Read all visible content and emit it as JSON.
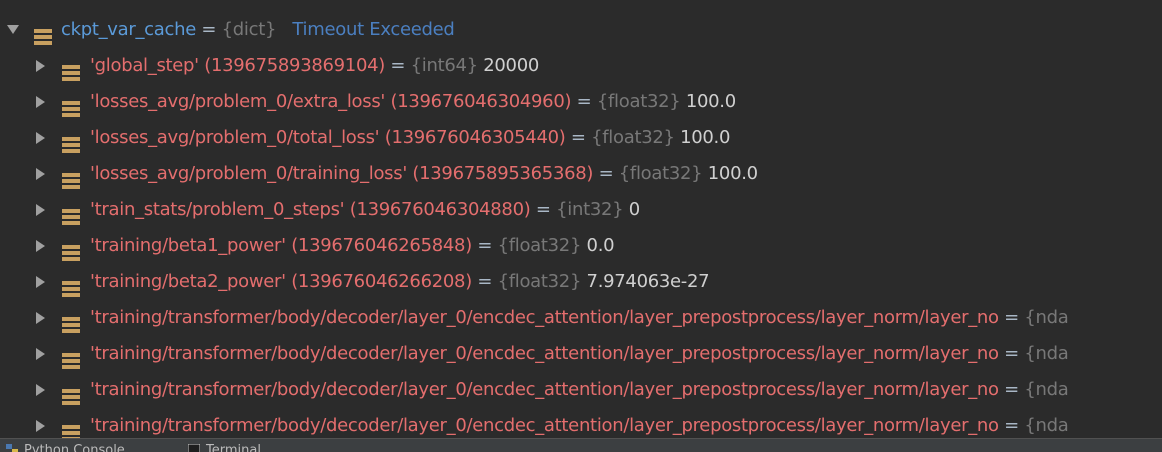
{
  "parent": {
    "name": "ckpt_var_cache",
    "eq": "=",
    "type": "{dict}",
    "warning": "Timeout Exceeded"
  },
  "items": [
    {
      "name": "'global_step' (139675893869104)",
      "eq": "=",
      "type": "{int64}",
      "value": "20000"
    },
    {
      "name": "'losses_avg/problem_0/extra_loss' (139676046304960)",
      "eq": "=",
      "type": "{float32}",
      "value": "100.0"
    },
    {
      "name": "'losses_avg/problem_0/total_loss' (139676046305440)",
      "eq": "=",
      "type": "{float32}",
      "value": "100.0"
    },
    {
      "name": "'losses_avg/problem_0/training_loss' (139675895365368)",
      "eq": "=",
      "type": "{float32}",
      "value": "100.0"
    },
    {
      "name": "'train_stats/problem_0_steps' (139676046304880)",
      "eq": "=",
      "type": "{int32}",
      "value": "0"
    },
    {
      "name": "'training/beta1_power' (139676046265848)",
      "eq": "=",
      "type": "{float32}",
      "value": "0.0"
    },
    {
      "name": "'training/beta2_power' (139676046266208)",
      "eq": "=",
      "type": "{float32}",
      "value": "7.974063e-27"
    },
    {
      "name": "'training/transformer/body/decoder/layer_0/encdec_attention/layer_prepostprocess/layer_norm/layer_no",
      "eq": "=",
      "type": "{nda",
      "value": ""
    },
    {
      "name": "'training/transformer/body/decoder/layer_0/encdec_attention/layer_prepostprocess/layer_norm/layer_no",
      "eq": "=",
      "type": "{nda",
      "value": ""
    },
    {
      "name": "'training/transformer/body/decoder/layer_0/encdec_attention/layer_prepostprocess/layer_norm/layer_no",
      "eq": "=",
      "type": "{nda",
      "value": ""
    },
    {
      "name": "'training/transformer/body/decoder/layer_0/encdec_attention/layer_prepostprocess/layer_norm/layer_no",
      "eq": "=",
      "type": "{nda",
      "value": ""
    }
  ],
  "bottom_tabs": [
    {
      "label": "Python Console",
      "icon": "python-icon"
    },
    {
      "label": "Terminal",
      "icon": "terminal-icon"
    }
  ],
  "colors": {
    "background": "#2b2b2b",
    "name_red": "#e46e6e",
    "name_blue": "#5b9ad8",
    "type_gray": "#787878",
    "value": "#d0d0d0",
    "warning": "#4b7fc0",
    "var_icon": "#c8a060"
  }
}
